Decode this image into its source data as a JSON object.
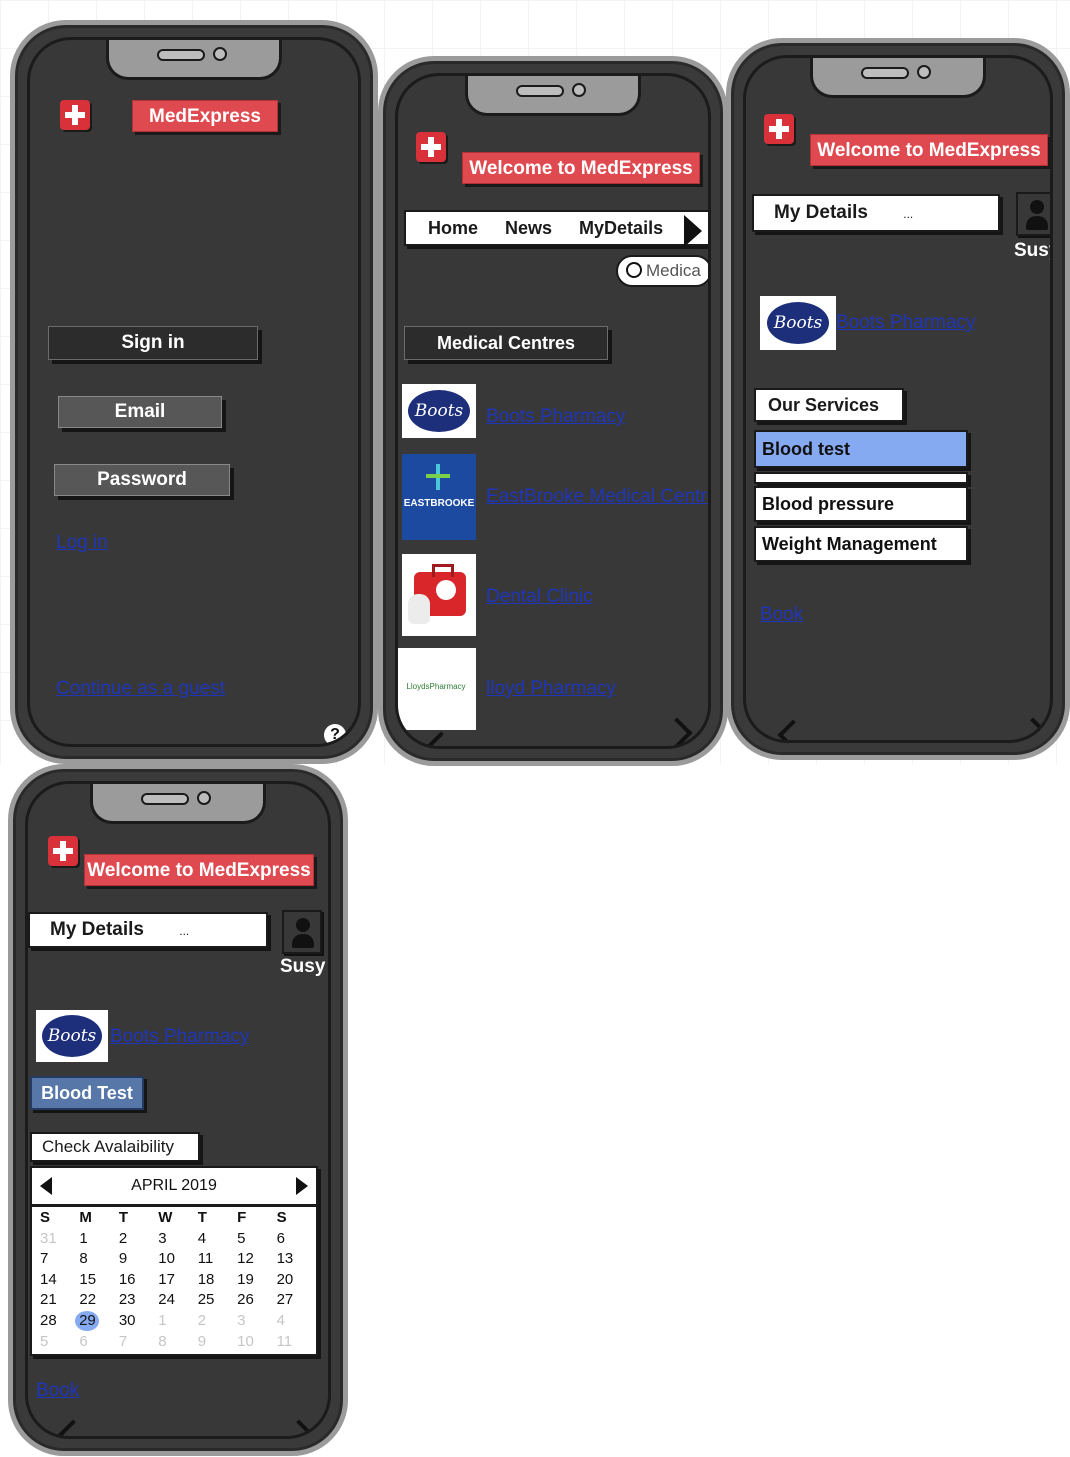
{
  "screen_login": {
    "title": "MedExpress",
    "sign_in": "Sign in",
    "email": "Email",
    "password": "Password",
    "login_link": "Log in",
    "guest_link": "Continue as a guest",
    "help_icon": "?"
  },
  "screen_centres": {
    "title": "Welcome to MedExpress",
    "nav": [
      "Home",
      "News",
      "MyDetails"
    ],
    "search_value": "Medica",
    "section": "Medical Centres",
    "centres": [
      {
        "name": "Boots Pharmacy",
        "logo_text": "Boots"
      },
      {
        "name": "EastBrooke Medical Centre",
        "logo_text": "EASTBROOKE"
      },
      {
        "name": "Dental Clinic",
        "logo_text": ""
      },
      {
        "name": "lloyd Pharmacy",
        "logo_text": "LloydsPharmacy"
      }
    ]
  },
  "screen_services": {
    "title": "Welcome to MedExpress",
    "my_details": "My Details",
    "ellipsis": "...",
    "user": "Susy",
    "pharmacy": "Boots Pharmacy",
    "pharmacy_logo": "Boots",
    "services_label": "Our Services",
    "services": [
      "Blood test",
      "Blood pressure",
      "Weight Management"
    ],
    "book": "Book"
  },
  "screen_booking": {
    "title": "Welcome to MedExpress",
    "my_details": "My Details",
    "ellipsis": "...",
    "user": "Susy",
    "pharmacy": "Boots Pharmacy",
    "pharmacy_logo": "Boots",
    "service": "Blood Test",
    "availability": "Check Avalaibility",
    "calendar": {
      "month": "APRIL 2019",
      "weekdays": [
        "S",
        "M",
        "T",
        "W",
        "T",
        "F",
        "S"
      ],
      "days": [
        "31",
        "1",
        "2",
        "3",
        "4",
        "5",
        "6",
        "7",
        "8",
        "9",
        "10",
        "11",
        "12",
        "13",
        "14",
        "15",
        "16",
        "17",
        "18",
        "19",
        "20",
        "21",
        "22",
        "23",
        "24",
        "25",
        "26",
        "27",
        "28",
        "29",
        "30",
        "1",
        "2",
        "3",
        "4",
        "5",
        "6",
        "7",
        "8",
        "9",
        "10",
        "11"
      ],
      "muted_indices": [
        0,
        31,
        32,
        33,
        34,
        35,
        36,
        37,
        38,
        39,
        40,
        41
      ],
      "selected_index": 29
    },
    "book": "Book"
  },
  "colors": {
    "brand_red": "#df4a50",
    "link_blue": "#1f36b8",
    "selected_blue": "#86aaf2",
    "service_button_blue": "#5677a8"
  },
  "icons": [
    "plus-cross-icon",
    "search-icon",
    "help-icon",
    "user-avatar-icon",
    "chevron-left-icon",
    "chevron-right-icon",
    "arrow-right-icon"
  ]
}
